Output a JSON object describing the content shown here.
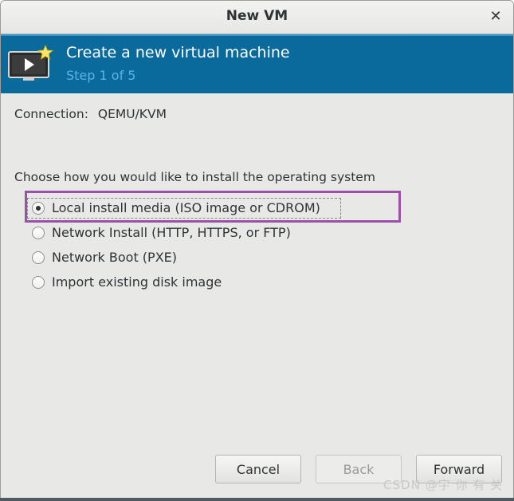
{
  "window": {
    "title": "New VM",
    "close_glyph": "✕"
  },
  "header": {
    "icon": "virtual-machine-new-icon",
    "title": "Create a new virtual machine",
    "step": "Step 1 of 5",
    "background_color": "#0b6a9c"
  },
  "connection": {
    "label": "Connection:",
    "value": "QEMU/KVM"
  },
  "install": {
    "prompt": "Choose how you would like to install the operating system",
    "options": [
      {
        "label": "Local install media (ISO image or CDROM)",
        "checked": true
      },
      {
        "label": "Network Install (HTTP, HTTPS, or FTP)",
        "checked": false
      },
      {
        "label": "Network Boot (PXE)",
        "checked": false
      },
      {
        "label": "Import existing disk image",
        "checked": false
      }
    ]
  },
  "annotation": {
    "highlight_color": "#9b51a6"
  },
  "buttons": {
    "cancel": "Cancel",
    "back": "Back",
    "forward": "Forward"
  },
  "watermark": "CSDN @宇 你 有 关"
}
